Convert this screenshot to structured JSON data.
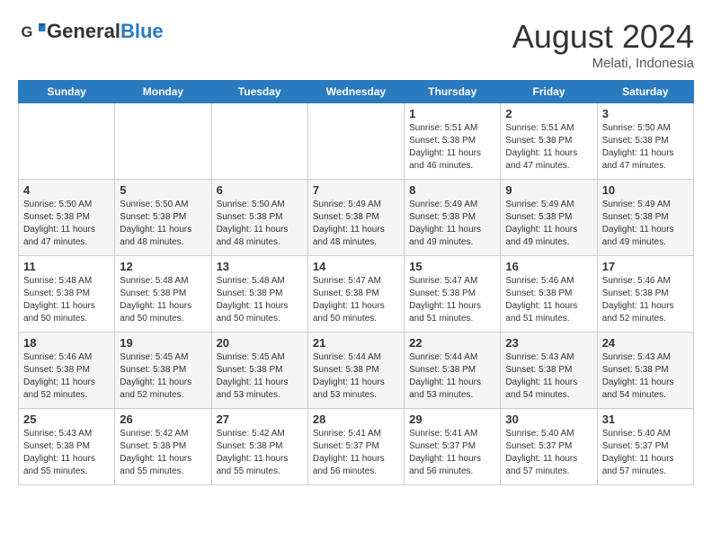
{
  "header": {
    "logo_general": "General",
    "logo_blue": "Blue",
    "month_title": "August 2024",
    "location": "Melati, Indonesia"
  },
  "days_of_week": [
    "Sunday",
    "Monday",
    "Tuesday",
    "Wednesday",
    "Thursday",
    "Friday",
    "Saturday"
  ],
  "weeks": [
    [
      {
        "day": "",
        "info": ""
      },
      {
        "day": "",
        "info": ""
      },
      {
        "day": "",
        "info": ""
      },
      {
        "day": "",
        "info": ""
      },
      {
        "day": "1",
        "info": "Sunrise: 5:51 AM\nSunset: 5:38 PM\nDaylight: 11 hours and 46 minutes."
      },
      {
        "day": "2",
        "info": "Sunrise: 5:51 AM\nSunset: 5:38 PM\nDaylight: 11 hours and 47 minutes."
      },
      {
        "day": "3",
        "info": "Sunrise: 5:50 AM\nSunset: 5:38 PM\nDaylight: 11 hours and 47 minutes."
      }
    ],
    [
      {
        "day": "4",
        "info": "Sunrise: 5:50 AM\nSunset: 5:38 PM\nDaylight: 11 hours and 47 minutes."
      },
      {
        "day": "5",
        "info": "Sunrise: 5:50 AM\nSunset: 5:38 PM\nDaylight: 11 hours and 48 minutes."
      },
      {
        "day": "6",
        "info": "Sunrise: 5:50 AM\nSunset: 5:38 PM\nDaylight: 11 hours and 48 minutes."
      },
      {
        "day": "7",
        "info": "Sunrise: 5:49 AM\nSunset: 5:38 PM\nDaylight: 11 hours and 48 minutes."
      },
      {
        "day": "8",
        "info": "Sunrise: 5:49 AM\nSunset: 5:38 PM\nDaylight: 11 hours and 49 minutes."
      },
      {
        "day": "9",
        "info": "Sunrise: 5:49 AM\nSunset: 5:38 PM\nDaylight: 11 hours and 49 minutes."
      },
      {
        "day": "10",
        "info": "Sunrise: 5:49 AM\nSunset: 5:38 PM\nDaylight: 11 hours and 49 minutes."
      }
    ],
    [
      {
        "day": "11",
        "info": "Sunrise: 5:48 AM\nSunset: 5:38 PM\nDaylight: 11 hours and 50 minutes."
      },
      {
        "day": "12",
        "info": "Sunrise: 5:48 AM\nSunset: 5:38 PM\nDaylight: 11 hours and 50 minutes."
      },
      {
        "day": "13",
        "info": "Sunrise: 5:48 AM\nSunset: 5:38 PM\nDaylight: 11 hours and 50 minutes."
      },
      {
        "day": "14",
        "info": "Sunrise: 5:47 AM\nSunset: 5:38 PM\nDaylight: 11 hours and 50 minutes."
      },
      {
        "day": "15",
        "info": "Sunrise: 5:47 AM\nSunset: 5:38 PM\nDaylight: 11 hours and 51 minutes."
      },
      {
        "day": "16",
        "info": "Sunrise: 5:46 AM\nSunset: 5:38 PM\nDaylight: 11 hours and 51 minutes."
      },
      {
        "day": "17",
        "info": "Sunrise: 5:46 AM\nSunset: 5:38 PM\nDaylight: 11 hours and 52 minutes."
      }
    ],
    [
      {
        "day": "18",
        "info": "Sunrise: 5:46 AM\nSunset: 5:38 PM\nDaylight: 11 hours and 52 minutes."
      },
      {
        "day": "19",
        "info": "Sunrise: 5:45 AM\nSunset: 5:38 PM\nDaylight: 11 hours and 52 minutes."
      },
      {
        "day": "20",
        "info": "Sunrise: 5:45 AM\nSunset: 5:38 PM\nDaylight: 11 hours and 53 minutes."
      },
      {
        "day": "21",
        "info": "Sunrise: 5:44 AM\nSunset: 5:38 PM\nDaylight: 11 hours and 53 minutes."
      },
      {
        "day": "22",
        "info": "Sunrise: 5:44 AM\nSunset: 5:38 PM\nDaylight: 11 hours and 53 minutes."
      },
      {
        "day": "23",
        "info": "Sunrise: 5:43 AM\nSunset: 5:38 PM\nDaylight: 11 hours and 54 minutes."
      },
      {
        "day": "24",
        "info": "Sunrise: 5:43 AM\nSunset: 5:38 PM\nDaylight: 11 hours and 54 minutes."
      }
    ],
    [
      {
        "day": "25",
        "info": "Sunrise: 5:43 AM\nSunset: 5:38 PM\nDaylight: 11 hours and 55 minutes."
      },
      {
        "day": "26",
        "info": "Sunrise: 5:42 AM\nSunset: 5:38 PM\nDaylight: 11 hours and 55 minutes."
      },
      {
        "day": "27",
        "info": "Sunrise: 5:42 AM\nSunset: 5:38 PM\nDaylight: 11 hours and 55 minutes."
      },
      {
        "day": "28",
        "info": "Sunrise: 5:41 AM\nSunset: 5:37 PM\nDaylight: 11 hours and 56 minutes."
      },
      {
        "day": "29",
        "info": "Sunrise: 5:41 AM\nSunset: 5:37 PM\nDaylight: 11 hours and 56 minutes."
      },
      {
        "day": "30",
        "info": "Sunrise: 5:40 AM\nSunset: 5:37 PM\nDaylight: 11 hours and 57 minutes."
      },
      {
        "day": "31",
        "info": "Sunrise: 5:40 AM\nSunset: 5:37 PM\nDaylight: 11 hours and 57 minutes."
      }
    ]
  ]
}
